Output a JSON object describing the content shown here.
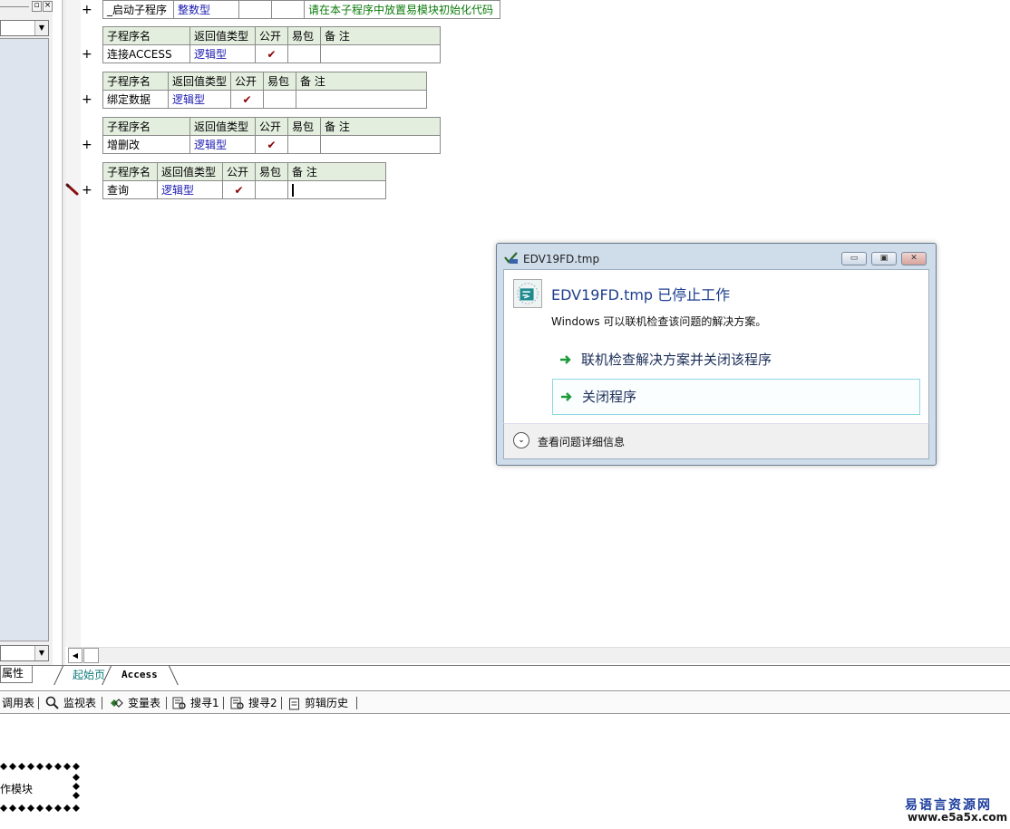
{
  "left_panel": {
    "attr_tab_label": "属性"
  },
  "editor": {
    "startup_row": {
      "name": "_启动子程序",
      "return_type": "整数型",
      "comment": "请在本子程序中放置易模块初始化代码"
    },
    "header": {
      "name": "子程序名",
      "return_type": "返回值类型",
      "public": "公开",
      "easy_pkg": "易包",
      "comment": "备 注"
    },
    "subroutines": [
      {
        "name": "连接ACCESS",
        "return_type": "逻辑型",
        "public": "✔"
      },
      {
        "name": "绑定数据",
        "return_type": "逻辑型",
        "public": "✔"
      },
      {
        "name": "增删改",
        "return_type": "逻辑型",
        "public": "✔"
      },
      {
        "name": "查询",
        "return_type": "逻辑型",
        "public": "✔"
      }
    ],
    "expand_symbol": "+"
  },
  "file_tabs": {
    "start_page": "起始页",
    "access": "Access"
  },
  "bottom_toolbar": {
    "items": [
      "调用表",
      "监视表",
      "变量表",
      "搜寻1",
      "搜寻2",
      "剪辑历史"
    ]
  },
  "module": {
    "label": "作模块"
  },
  "watermark": {
    "title": "易语言资源网",
    "url": "www.e5a5x.com"
  },
  "dialog": {
    "window_title": "EDV19FD.tmp",
    "heading": "EDV19FD.tmp 已停止工作",
    "description": "Windows 可以联机检查该问题的解决方案。",
    "option_online": "联机检查解决方案并关闭该程序",
    "option_close": "关闭程序",
    "details_label": "查看问题详细信息"
  },
  "colors": {
    "header_bg": "#e4eedf",
    "type_text": "#1a1ab0",
    "comment_text": "#0a7a0a",
    "dialog_frame": "#cfdcea",
    "dialog_heading": "#1e3f8f",
    "active_tab": "#0f7a7a"
  }
}
